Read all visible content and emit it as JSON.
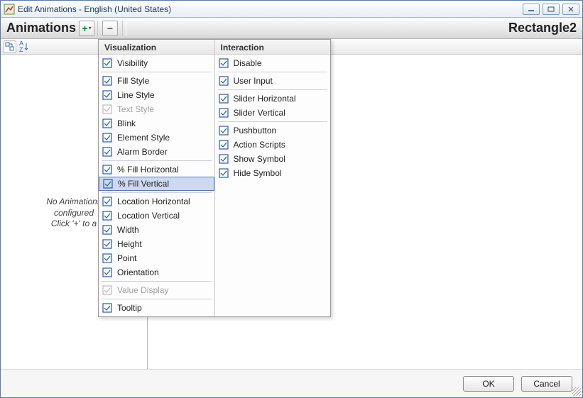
{
  "window": {
    "title": "Edit Animations - English (United States)"
  },
  "header": {
    "section_label": "Animations",
    "object_label": "Rectangle2",
    "plus": "+",
    "minus": "−"
  },
  "empty": {
    "line1": "No Animations",
    "line2": "configured",
    "line3": "Click '+' to a"
  },
  "menu": {
    "vis_header": "Visualization",
    "int_header": "Interaction",
    "visualization": [
      {
        "label": "Visibility",
        "disabled": false
      },
      {
        "label": "Fill Style",
        "disabled": false
      },
      {
        "label": "Line Style",
        "disabled": false
      },
      {
        "label": "Text Style",
        "disabled": true
      },
      {
        "label": "Blink",
        "disabled": false
      },
      {
        "label": "Element Style",
        "disabled": false
      },
      {
        "label": "Alarm Border",
        "disabled": false
      },
      {
        "label": "% Fill Horizontal",
        "disabled": false
      },
      {
        "label": "% Fill Vertical",
        "disabled": false,
        "selected": true
      },
      {
        "label": "Location Horizontal",
        "disabled": false
      },
      {
        "label": "Location Vertical",
        "disabled": false
      },
      {
        "label": "Width",
        "disabled": false
      },
      {
        "label": "Height",
        "disabled": false
      },
      {
        "label": "Point",
        "disabled": false
      },
      {
        "label": "Orientation",
        "disabled": false
      },
      {
        "label": "Value Display",
        "disabled": true
      },
      {
        "label": "Tooltip",
        "disabled": false
      }
    ],
    "interaction": [
      {
        "label": "Disable"
      },
      {
        "label": "User Input"
      },
      {
        "label": "Slider Horizontal"
      },
      {
        "label": "Slider Vertical"
      },
      {
        "label": "Pushbutton"
      },
      {
        "label": "Action Scripts"
      },
      {
        "label": "Show Symbol"
      },
      {
        "label": "Hide Symbol"
      }
    ],
    "vis_separators_after": [
      0,
      6,
      8,
      14,
      15
    ],
    "int_separators_after": [
      0,
      1,
      3
    ]
  },
  "footer": {
    "ok": "OK",
    "cancel": "Cancel"
  }
}
